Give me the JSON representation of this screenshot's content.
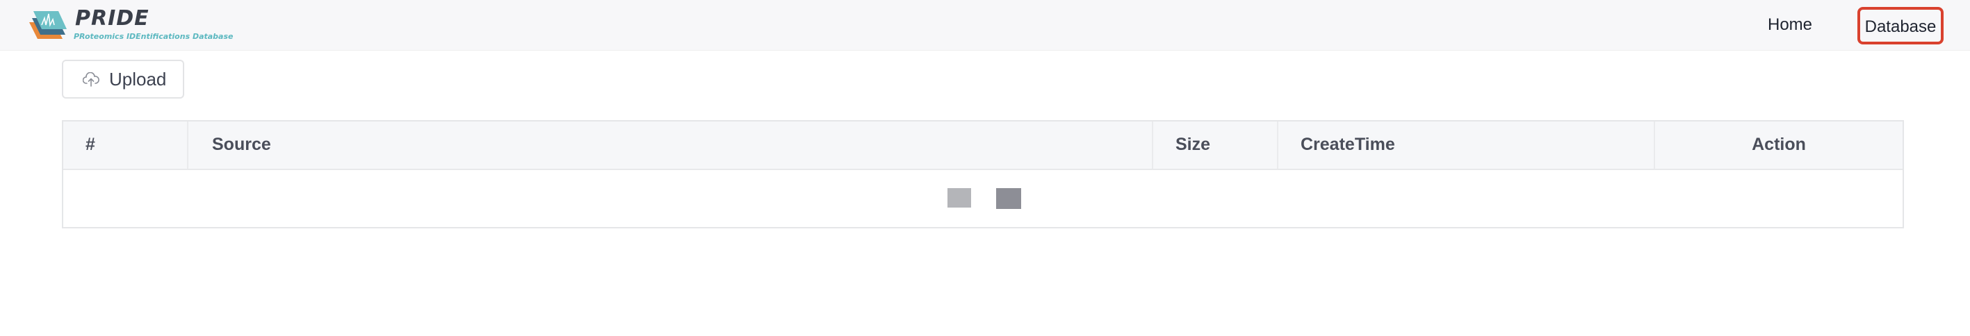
{
  "header": {
    "logo_title": "PRIDE",
    "logo_subtitle": "PRoteomics IDEntifications Database",
    "nav": {
      "home_label": "Home",
      "database_label": "Database"
    },
    "colors": {
      "highlight": "#d9412e",
      "logo_accent": "#5cb8c0"
    }
  },
  "toolbar": {
    "upload_label": "Upload",
    "upload_icon": "cloud-upload-icon"
  },
  "table": {
    "columns": [
      "#",
      "Source",
      "Size",
      "CreateTime",
      "Action"
    ],
    "rows": [],
    "state": "loading"
  }
}
